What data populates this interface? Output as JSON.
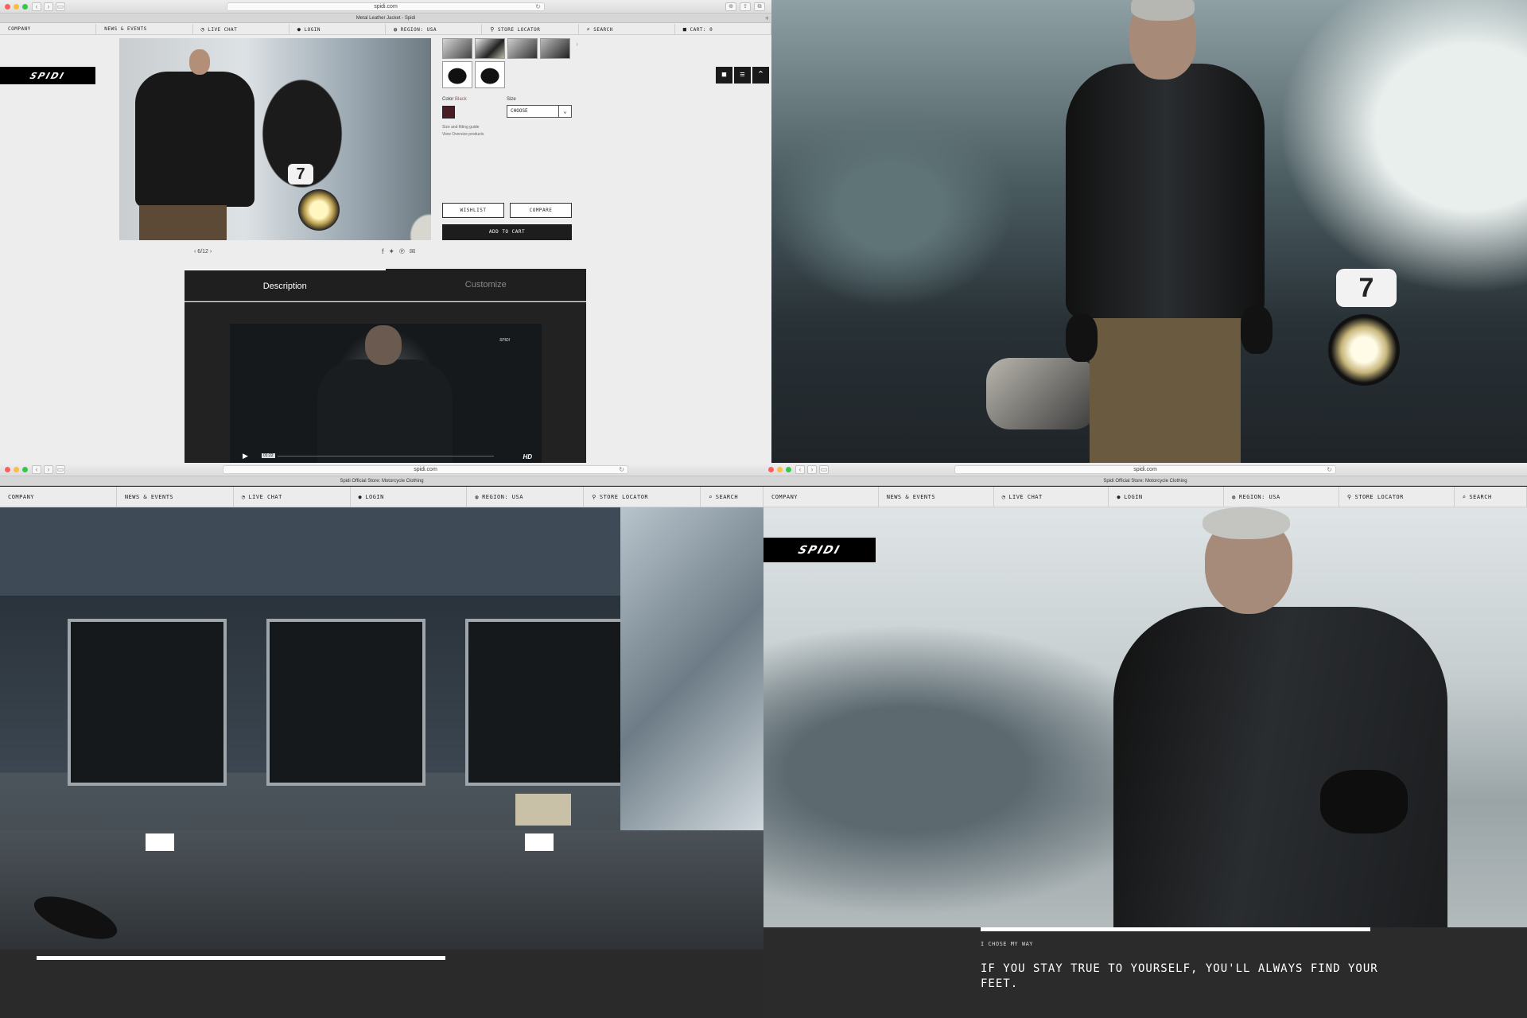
{
  "brand": {
    "logo_text": "SPIDI"
  },
  "menu": {
    "company": "COMPANY",
    "news": "NEWS & EVENTS",
    "live_chat": "LIVE CHAT",
    "login": "LOGIN",
    "region": "REGION: USA",
    "store_locator": "STORE LOCATOR",
    "search": "SEARCH",
    "cart": "CART: 0"
  },
  "window_top_left": {
    "url": "spidi.com",
    "tab_title": "Metal Leather Jacket - Spidi",
    "product": {
      "color_label": "Color",
      "color_value": "Black",
      "swatch_color": "#4a1d22",
      "size_label": "Size",
      "size_placeholder": "CHOOSE",
      "size_guide_link": "Size and fitting guide",
      "oversize_link": "View Oversize products",
      "wishlist_button": "WISHLIST",
      "compare_button": "COMPARE",
      "add_to_cart_button": "ADD TO CART",
      "pager": "6/12"
    },
    "tabs": {
      "description": "Description",
      "customize": "Customize"
    },
    "video": {
      "time": "01:22",
      "quality": "HD",
      "logo": "SPIDI"
    }
  },
  "window_bottom_left": {
    "url": "spidi.com",
    "tab_title": "Spidi Official Store: Motorcycle Clothing",
    "progress": 0.65
  },
  "window_bottom_right": {
    "url": "spidi.com",
    "tab_title": "Spidi Official Store: Motorcycle Clothing",
    "eyebrow": "I CHOSE MY WAY",
    "quote": "IF YOU STAY TRUE TO YOURSELF, YOU'LL ALWAYS FIND YOUR FEET.",
    "progress": 0.7
  },
  "motorcycle_number": "7",
  "colors": {
    "accent_dark": "#1d1d1d",
    "panel_dark": "#2b2b2b"
  }
}
